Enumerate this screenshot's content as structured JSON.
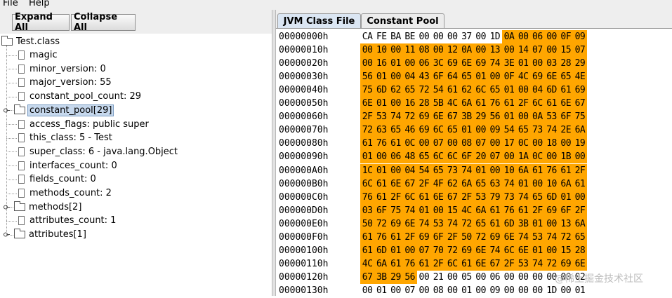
{
  "menu": {
    "file": "File",
    "help": "Help"
  },
  "toolbar": {
    "expand_all": "Expand All",
    "collapse_all": "Collapse All"
  },
  "tree": {
    "root": "Test.class",
    "items": [
      {
        "label": "magic",
        "expandable": false,
        "selected": false
      },
      {
        "label": "minor_version: 0",
        "expandable": false,
        "selected": false
      },
      {
        "label": "major_version: 55",
        "expandable": false,
        "selected": false
      },
      {
        "label": "constant_pool_count: 29",
        "expandable": false,
        "selected": false
      },
      {
        "label": "constant_pool[29]",
        "expandable": true,
        "selected": true
      },
      {
        "label": "access_flags: public super",
        "expandable": false,
        "selected": false
      },
      {
        "label": "this_class: 5 - Test",
        "expandable": false,
        "selected": false
      },
      {
        "label": "super_class: 6 - java.lang.Object",
        "expandable": false,
        "selected": false
      },
      {
        "label": "interfaces_count: 0",
        "expandable": false,
        "selected": false
      },
      {
        "label": "fields_count: 0",
        "expandable": false,
        "selected": false
      },
      {
        "label": "methods_count: 2",
        "expandable": false,
        "selected": false
      },
      {
        "label": "methods[2]",
        "expandable": true,
        "selected": false
      },
      {
        "label": "attributes_count: 1",
        "expandable": false,
        "selected": false
      },
      {
        "label": "attributes[1]",
        "expandable": true,
        "selected": false
      }
    ]
  },
  "tabs": [
    {
      "label": "JVM Class File",
      "selected": true
    },
    {
      "label": "Constant Pool",
      "selected": false
    }
  ],
  "hex": {
    "rows": [
      {
        "addr": "00000000h",
        "bytes": "CA FE BA BE 00 00 00 37 00 1D 0A 00 06 00 0F 09"
      },
      {
        "addr": "00000010h",
        "bytes": "00 10 00 11 08 00 12 0A 00 13 00 14 07 00 15 07"
      },
      {
        "addr": "00000020h",
        "bytes": "00 16 01 00 06 3C 69 6E 69 74 3E 01 00 03 28 29"
      },
      {
        "addr": "00000030h",
        "bytes": "56 01 00 04 43 6F 64 65 01 00 0F 4C 69 6E 65 4E"
      },
      {
        "addr": "00000040h",
        "bytes": "75 6D 62 65 72 54 61 62 6C 65 01 00 04 6D 61 69"
      },
      {
        "addr": "00000050h",
        "bytes": "6E 01 00 16 28 5B 4C 6A 61 76 61 2F 6C 61 6E 67"
      },
      {
        "addr": "00000060h",
        "bytes": "2F 53 74 72 69 6E 67 3B 29 56 01 00 0A 53 6F 75"
      },
      {
        "addr": "00000070h",
        "bytes": "72 63 65 46 69 6C 65 01 00 09 54 65 73 74 2E 6A"
      },
      {
        "addr": "00000080h",
        "bytes": "61 76 61 0C 00 07 00 08 07 00 17 0C 00 18 00 19"
      },
      {
        "addr": "00000090h",
        "bytes": "01 00 06 48 65 6C 6C 6F 20 07 00 1A 0C 00 1B 00"
      },
      {
        "addr": "000000A0h",
        "bytes": "1C 01 00 04 54 65 73 74 01 00 10 6A 61 76 61 2F"
      },
      {
        "addr": "000000B0h",
        "bytes": "6C 61 6E 67 2F 4F 62 6A 65 63 74 01 00 10 6A 61"
      },
      {
        "addr": "000000C0h",
        "bytes": "76 61 2F 6C 61 6E 67 2F 53 79 73 74 65 6D 01 00"
      },
      {
        "addr": "000000D0h",
        "bytes": "03 6F 75 74 01 00 15 4C 6A 61 76 61 2F 69 6F 2F"
      },
      {
        "addr": "000000E0h",
        "bytes": "50 72 69 6E 74 53 74 72 65 61 6D 3B 01 00 13 6A"
      },
      {
        "addr": "000000F0h",
        "bytes": "61 76 61 2F 69 6F 2F 50 72 69 6E 74 53 74 72 65"
      },
      {
        "addr": "00000100h",
        "bytes": "61 6D 01 00 07 70 72 69 6E 74 6C 6E 01 00 15 28"
      },
      {
        "addr": "00000110h",
        "bytes": "4C 6A 61 76 61 2F 6C 61 6E 67 2F 53 74 72 69 6E"
      },
      {
        "addr": "00000120h",
        "bytes": "67 3B 29 56 00 21 00 05 00 06 00 00 00 00 00 02"
      },
      {
        "addr": "00000130h",
        "bytes": "00 01 00 07 00 08 00 01 00 09 00 00 00 1D 00 01"
      }
    ],
    "highlight_color": "#FFA600"
  },
  "watermark": "@稀土掘金技术社区"
}
